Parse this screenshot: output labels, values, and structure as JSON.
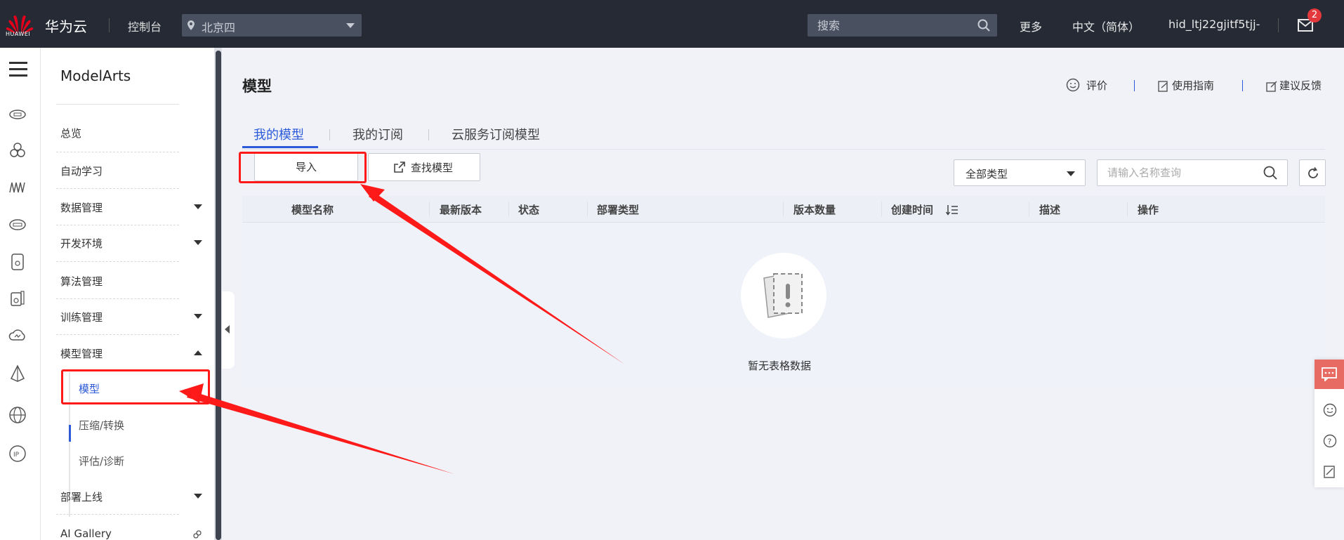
{
  "topbar": {
    "logo_text": "HUAWEI",
    "brand": "华为云",
    "console": "控制台",
    "region": "北京四",
    "search_placeholder": "搜索",
    "more": "更多",
    "language": "中文（简体）",
    "user": "hid_ltj22gjitf5tjj-",
    "mail_badge": "2"
  },
  "sidebar": {
    "title": "ModelArts",
    "items": [
      {
        "label": "总览"
      },
      {
        "label": "自动学习"
      },
      {
        "label": "数据管理"
      },
      {
        "label": "开发环境"
      },
      {
        "label": "算法管理"
      },
      {
        "label": "训练管理"
      },
      {
        "label": "模型管理"
      },
      {
        "label": "部署上线"
      },
      {
        "label": "AI Gallery"
      }
    ],
    "subitems": [
      {
        "label": "模型",
        "active": true
      },
      {
        "label": "压缩/转换"
      },
      {
        "label": "评估/诊断"
      }
    ]
  },
  "main": {
    "title": "模型",
    "header_links": {
      "rate": "评价",
      "guide": "使用指南",
      "feedback": "建议反馈"
    },
    "tabs": [
      {
        "label": "我的模型",
        "active": true
      },
      {
        "label": "我的订阅"
      },
      {
        "label": "云服务订阅模型"
      }
    ],
    "toolbar": {
      "import_label": "导入",
      "find_label": "查找模型",
      "type_select": "全部类型",
      "search_placeholder": "请输入名称查询"
    },
    "table": {
      "columns": [
        "模型名称",
        "最新版本",
        "状态",
        "部署类型",
        "版本数量",
        "创建时间",
        "描述",
        "操作"
      ],
      "empty_text": "暂无表格数据"
    }
  },
  "colors": {
    "topbar_bg": "#252a35",
    "accent": "#2c5ad8",
    "annotation": "#ff1a1a",
    "float_accent": "#e86b63"
  }
}
